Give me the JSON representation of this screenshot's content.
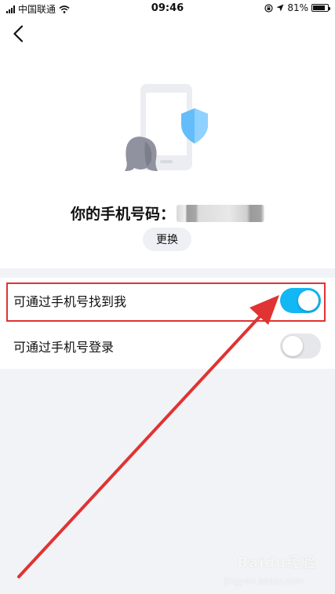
{
  "status_bar": {
    "carrier": "中国联通",
    "time": "09:46",
    "battery": "81%",
    "battery_level": 0.81,
    "icons": [
      "signal-icon",
      "wifi-icon",
      "lock-rotation-icon",
      "location-icon",
      "battery-icon"
    ]
  },
  "header": {
    "back_icon": "chevron-left-icon"
  },
  "illustration": {
    "icons": [
      "phone-icon",
      "shield-icon",
      "penguin-icon"
    ]
  },
  "phone": {
    "label": "你的手机号码："
  },
  "change_button": {
    "label": "更换"
  },
  "settings": [
    {
      "label": "可通过手机号找到我",
      "enabled": true
    },
    {
      "label": "可通过手机号登录",
      "enabled": false
    }
  ],
  "colors": {
    "toggle_on": "#12b7f5",
    "toggle_off": "#e6e7eb",
    "annotation": "#e03333",
    "background": "#f2f3f6"
  },
  "watermark": {
    "brand": "Baidu经验",
    "url": "jingyan.baidu.com"
  }
}
